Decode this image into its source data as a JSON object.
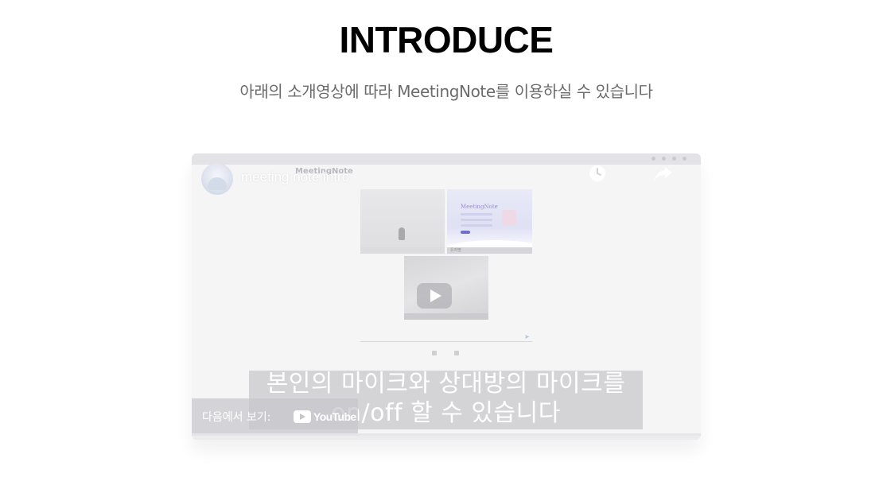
{
  "header": {
    "title": "INTRODUCE",
    "subtitle": "아래의 소개영상에 따라 MeetingNote를 이용하실 수 있습니다"
  },
  "video": {
    "title": "meeting note intro",
    "app_label": "MeetingNote",
    "caption_line1": "본인의 마이크와 상대방의 마이크를",
    "caption_line2": "on/off 할 수 있습니다",
    "watch_on_label": "다음에서 보기:",
    "youtube_logo_text": "YouTube",
    "preview_brand": "MeetingNote",
    "preview_bar_label": "유저명"
  },
  "icons": {
    "watch_later": "clock-icon",
    "share": "share-icon",
    "play": "play-icon",
    "youtube": "youtube-logo-icon",
    "avatar": "channel-avatar"
  },
  "colors": {
    "title": "#000000",
    "subtitle": "#6b6b6b",
    "caption": "#ffffff"
  }
}
